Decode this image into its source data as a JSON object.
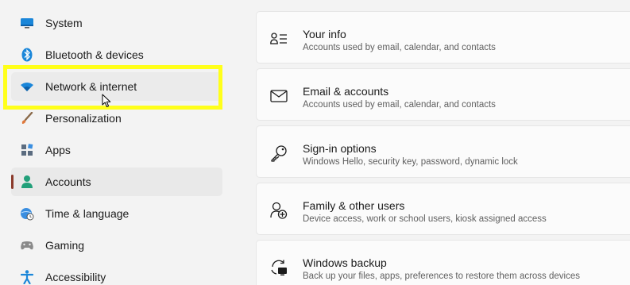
{
  "sidebar": {
    "items": [
      {
        "label": "System",
        "icon": "monitor-icon"
      },
      {
        "label": "Bluetooth & devices",
        "icon": "bluetooth-icon"
      },
      {
        "label": "Network & internet",
        "icon": "wifi-icon"
      },
      {
        "label": "Personalization",
        "icon": "paintbrush-icon"
      },
      {
        "label": "Apps",
        "icon": "apps-icon"
      },
      {
        "label": "Accounts",
        "icon": "person-icon"
      },
      {
        "label": "Time & language",
        "icon": "globe-clock-icon"
      },
      {
        "label": "Gaming",
        "icon": "gamepad-icon"
      },
      {
        "label": "Accessibility",
        "icon": "accessibility-icon"
      }
    ],
    "selected": "Accounts",
    "highlighted": "Network & internet"
  },
  "main": {
    "cards": [
      {
        "title": "Your info",
        "subtitle": "Accounts used by email, calendar, and contacts",
        "icon": "user-info-icon"
      },
      {
        "title": "Email & accounts",
        "subtitle": "Accounts used by email, calendar, and contacts",
        "icon": "mail-icon"
      },
      {
        "title": "Sign-in options",
        "subtitle": "Windows Hello, security key, password, dynamic lock",
        "icon": "key-icon"
      },
      {
        "title": "Family & other users",
        "subtitle": "Device access, work or school users, kiosk assigned access",
        "icon": "add-user-icon"
      },
      {
        "title": "Windows backup",
        "subtitle": "Back up your files, apps, preferences to restore them across devices",
        "icon": "backup-icon"
      }
    ]
  },
  "colors": {
    "highlight": "#ffff1a",
    "accent": "#0078d4",
    "selected_indicator": "#8a3a2b"
  }
}
